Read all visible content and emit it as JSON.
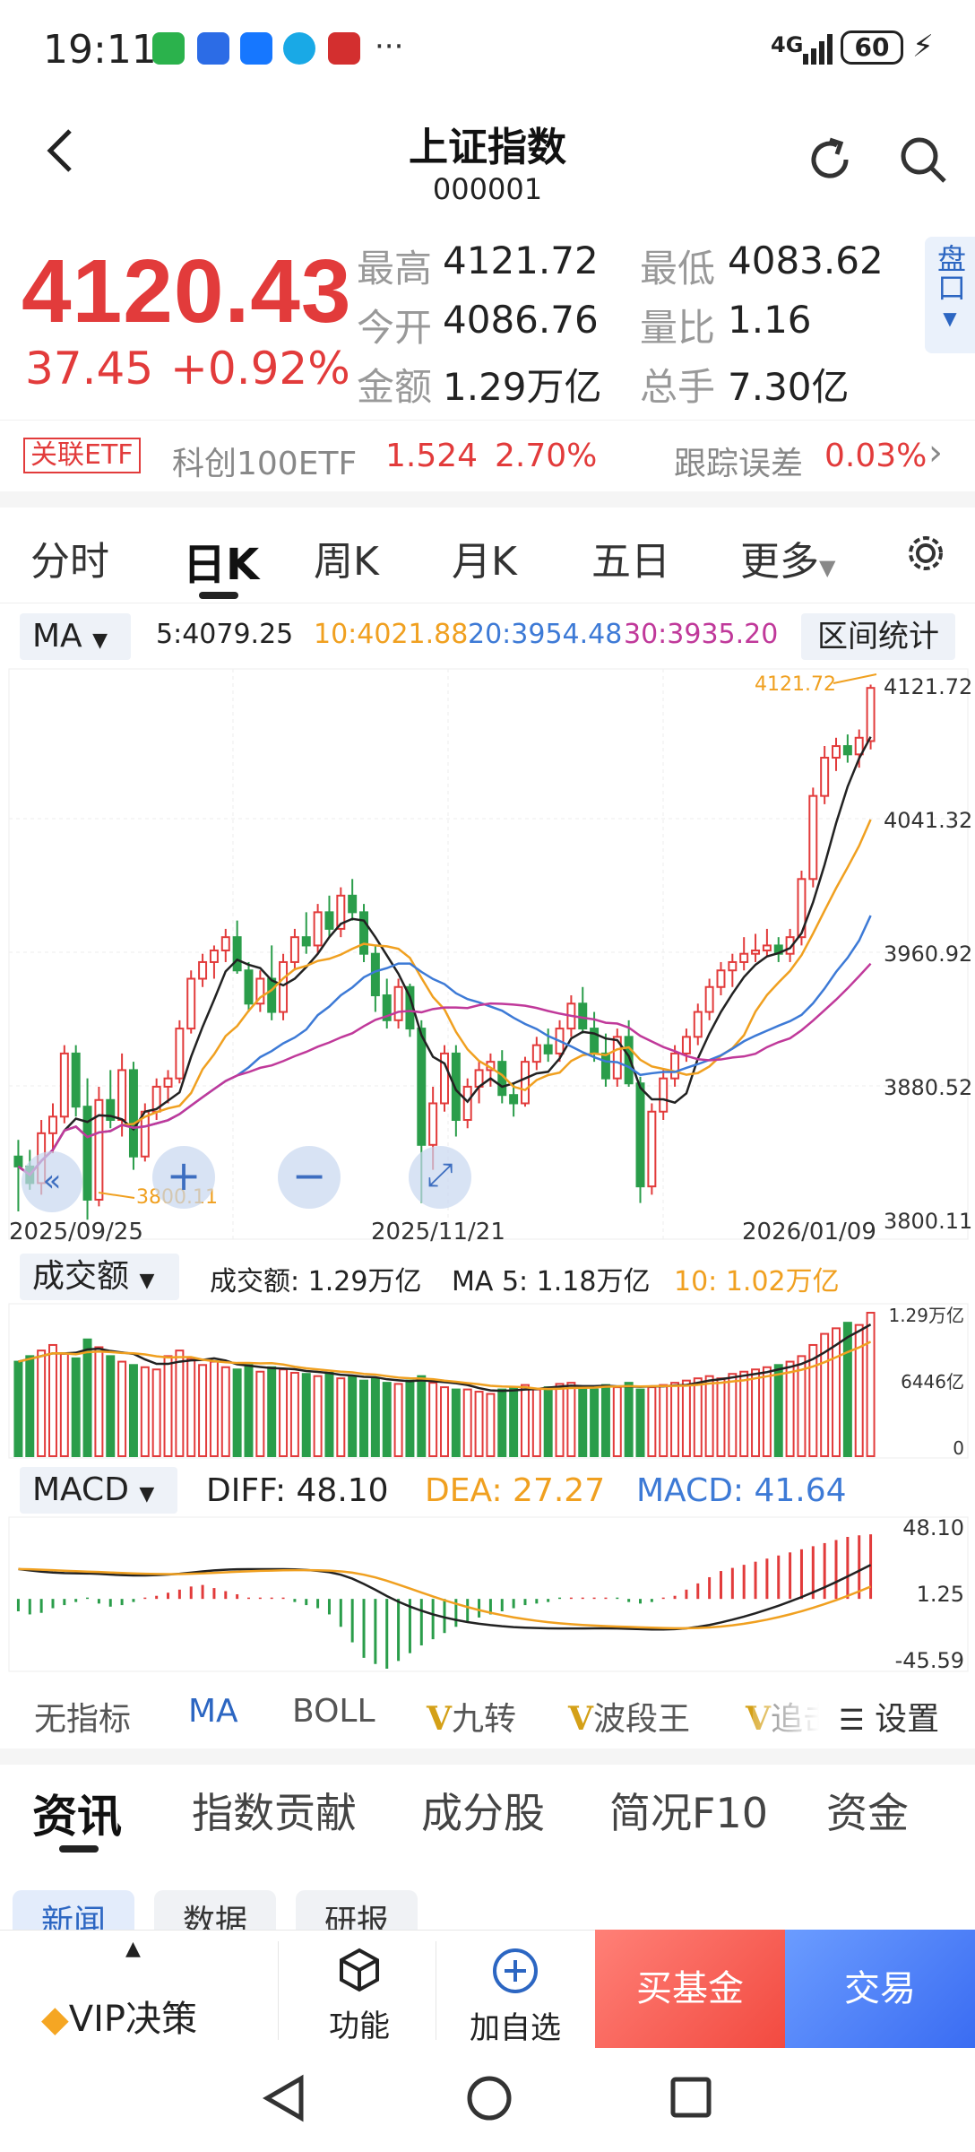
{
  "status": {
    "time": "19:11",
    "network": "4G",
    "battery": "60"
  },
  "header": {
    "title": "上证指数",
    "code": "000001"
  },
  "quote": {
    "price": "4120.43",
    "change": "37.45",
    "change_pct": "+0.92%",
    "high_label": "最高",
    "high": "4121.72",
    "low_label": "最低",
    "low": "4083.62",
    "open_label": "今开",
    "open": "4086.76",
    "vol_ratio_label": "量比",
    "vol_ratio": "1.16",
    "amount_label": "金额",
    "amount": "1.29万亿",
    "hands_label": "总手",
    "hands": "7.30亿",
    "pan_label": "盘口"
  },
  "etf": {
    "tag": "关联ETF",
    "name": "科创100ETF",
    "price": "1.524",
    "pct": "2.70%",
    "err_label": "跟踪误差",
    "err": "0.03%"
  },
  "period_tabs": [
    "分时",
    "日K",
    "周K",
    "月K",
    "五日",
    "更多"
  ],
  "ma_row": {
    "selector": "MA",
    "ma5": "5:4079.25",
    "ma10": "10:4021.88",
    "ma20": "20:3954.48",
    "ma30": "30:3935.20",
    "range_btn": "区间统计"
  },
  "kline_axis": {
    "y_ticks": [
      "4121.72",
      "4041.32",
      "3960.92",
      "3880.52",
      "3800.11"
    ],
    "x_ticks": [
      "2025/09/25",
      "2025/11/21",
      "2026/01/09"
    ],
    "high_marker": "4121.72",
    "low_marker": "3800.11"
  },
  "volume": {
    "selector": "成交额",
    "label": "成交额: 1.29万亿",
    "ma5": "MA 5: 1.18万亿",
    "ma10": "10: 1.02万亿",
    "y_ticks": [
      "1.29万亿",
      "6446亿",
      "0"
    ]
  },
  "macd": {
    "selector": "MACD",
    "diff": "DIFF: 48.10",
    "dea": "DEA: 27.27",
    "macd": "MACD: 41.64",
    "y_ticks": [
      "48.10",
      "1.25",
      "-45.59"
    ]
  },
  "indicator_tabs": [
    "无指标",
    "MA",
    "BOLL",
    "九转",
    "波段王",
    "追击"
  ],
  "indicator_settings": "设置",
  "news_tabs": [
    "资讯",
    "指数贡献",
    "成分股",
    "简况F10",
    "资金"
  ],
  "sub_tabs": [
    "新闻",
    "数据",
    "研报"
  ],
  "actions": {
    "vip": "VIP决策",
    "func": "功能",
    "watch": "加自选",
    "buy_fund": "买基金",
    "trade": "交易"
  },
  "colors": {
    "up": "#e23b3b",
    "down": "#2a9d4a",
    "ma5": "#222222",
    "ma10": "#f0a020",
    "ma20": "#3d7ad6",
    "ma30": "#c0399a",
    "accent": "#2c66c2"
  },
  "chart_data": {
    "type": "candlestick",
    "x_labels": [
      "2025/09/25",
      "2025/11/21",
      "2026/01/09"
    ],
    "ylim": [
      3800.11,
      4121.72
    ],
    "ohlc": [
      [
        3838,
        3848,
        3805,
        3832
      ],
      [
        3832,
        3842,
        3818,
        3822
      ],
      [
        3822,
        3860,
        3815,
        3852
      ],
      [
        3852,
        3870,
        3840,
        3862
      ],
      [
        3862,
        3905,
        3858,
        3900
      ],
      [
        3900,
        3905,
        3862,
        3868
      ],
      [
        3868,
        3885,
        3800,
        3812
      ],
      [
        3812,
        3880,
        3808,
        3872
      ],
      [
        3872,
        3890,
        3855,
        3860
      ],
      [
        3860,
        3900,
        3850,
        3890
      ],
      [
        3890,
        3895,
        3830,
        3838
      ],
      [
        3838,
        3870,
        3835,
        3865
      ],
      [
        3865,
        3885,
        3860,
        3880
      ],
      [
        3880,
        3890,
        3870,
        3885
      ],
      [
        3885,
        3920,
        3882,
        3915
      ],
      [
        3915,
        3950,
        3912,
        3945
      ],
      [
        3945,
        3960,
        3940,
        3955
      ],
      [
        3955,
        3965,
        3945,
        3962
      ],
      [
        3962,
        3975,
        3955,
        3970
      ],
      [
        3970,
        3980,
        3948,
        3950
      ],
      [
        3950,
        3955,
        3925,
        3930
      ],
      [
        3930,
        3950,
        3925,
        3945
      ],
      [
        3945,
        3965,
        3920,
        3925
      ],
      [
        3925,
        3960,
        3920,
        3955
      ],
      [
        3955,
        3975,
        3950,
        3970
      ],
      [
        3970,
        3985,
        3960,
        3965
      ],
      [
        3965,
        3990,
        3960,
        3985
      ],
      [
        3985,
        3995,
        3970,
        3975
      ],
      [
        3975,
        4000,
        3970,
        3995
      ],
      [
        3995,
        4005,
        3980,
        3985
      ],
      [
        3985,
        3990,
        3955,
        3960
      ],
      [
        3960,
        3965,
        3925,
        3935
      ],
      [
        3935,
        3945,
        3915,
        3920
      ],
      [
        3920,
        3945,
        3915,
        3940
      ],
      [
        3940,
        3942,
        3910,
        3915
      ],
      [
        3915,
        3920,
        3810,
        3845
      ],
      [
        3845,
        3880,
        3830,
        3870
      ],
      [
        3870,
        3905,
        3865,
        3900
      ],
      [
        3900,
        3905,
        3850,
        3860
      ],
      [
        3860,
        3885,
        3855,
        3880
      ],
      [
        3880,
        3895,
        3870,
        3890
      ],
      [
        3890,
        3900,
        3880,
        3895
      ],
      [
        3895,
        3902,
        3870,
        3875
      ],
      [
        3875,
        3882,
        3862,
        3870
      ],
      [
        3870,
        3898,
        3868,
        3895
      ],
      [
        3895,
        3910,
        3890,
        3905
      ],
      [
        3905,
        3915,
        3895,
        3900
      ],
      [
        3900,
        3920,
        3895,
        3915
      ],
      [
        3915,
        3935,
        3910,
        3930
      ],
      [
        3930,
        3940,
        3912,
        3915
      ],
      [
        3915,
        3925,
        3895,
        3900
      ],
      [
        3900,
        3912,
        3880,
        3885
      ],
      [
        3885,
        3915,
        3880,
        3910
      ],
      [
        3910,
        3920,
        3880,
        3882
      ],
      [
        3882,
        3886,
        3810,
        3820
      ],
      [
        3820,
        3870,
        3815,
        3865
      ],
      [
        3865,
        3890,
        3860,
        3885
      ],
      [
        3885,
        3905,
        3880,
        3900
      ],
      [
        3900,
        3915,
        3895,
        3910
      ],
      [
        3910,
        3930,
        3905,
        3925
      ],
      [
        3925,
        3945,
        3920,
        3940
      ],
      [
        3940,
        3955,
        3935,
        3950
      ],
      [
        3950,
        3960,
        3940,
        3955
      ],
      [
        3955,
        3970,
        3950,
        3960
      ],
      [
        3960,
        3972,
        3955,
        3962
      ],
      [
        3962,
        3975,
        3958,
        3965
      ],
      [
        3965,
        3970,
        3955,
        3960
      ],
      [
        3960,
        3975,
        3955,
        3970
      ],
      [
        3970,
        4010,
        3965,
        4005
      ],
      [
        4005,
        4060,
        4000,
        4055
      ],
      [
        4055,
        4085,
        4050,
        4078
      ],
      [
        4078,
        4090,
        4070,
        4085
      ],
      [
        4085,
        4092,
        4075,
        4080
      ],
      [
        4080,
        4095,
        4072,
        4090
      ],
      [
        4088,
        4122,
        4083,
        4120
      ]
    ],
    "volume": [
      0.85,
      0.9,
      0.95,
      1.0,
      0.92,
      0.88,
      1.05,
      0.98,
      0.9,
      0.85,
      0.82,
      0.8,
      0.78,
      0.9,
      0.95,
      0.88,
      0.82,
      0.85,
      0.8,
      0.78,
      0.82,
      0.76,
      0.8,
      0.78,
      0.75,
      0.74,
      0.72,
      0.75,
      0.7,
      0.72,
      0.68,
      0.7,
      0.66,
      0.65,
      0.68,
      0.72,
      0.66,
      0.62,
      0.6,
      0.6,
      0.58,
      0.56,
      0.6,
      0.62,
      0.64,
      0.6,
      0.62,
      0.65,
      0.66,
      0.62,
      0.6,
      0.64,
      0.62,
      0.66,
      0.6,
      0.62,
      0.64,
      0.66,
      0.68,
      0.7,
      0.72,
      0.7,
      0.74,
      0.76,
      0.78,
      0.8,
      0.82,
      0.85,
      0.9,
      1.0,
      1.1,
      1.15,
      1.2,
      1.18,
      1.29
    ],
    "macd_hist": [
      -8,
      -10,
      -9,
      -6,
      -4,
      -2,
      -1,
      -3,
      -5,
      -4,
      -2,
      0,
      2,
      4,
      6,
      8,
      9,
      7,
      5,
      3,
      1,
      0,
      0,
      0,
      -2,
      -4,
      -6,
      -10,
      -18,
      -28,
      -38,
      -42,
      -45,
      -40,
      -35,
      -30,
      -26,
      -22,
      -18,
      -15,
      -12,
      -10,
      -8,
      -6,
      -4,
      -3,
      -2,
      -1,
      0,
      0,
      1,
      0,
      -1,
      -2,
      -3,
      -2,
      0,
      2,
      6,
      10,
      14,
      18,
      20,
      22,
      24,
      26,
      28,
      30,
      32,
      34,
      36,
      38,
      40,
      41,
      41.64
    ]
  }
}
